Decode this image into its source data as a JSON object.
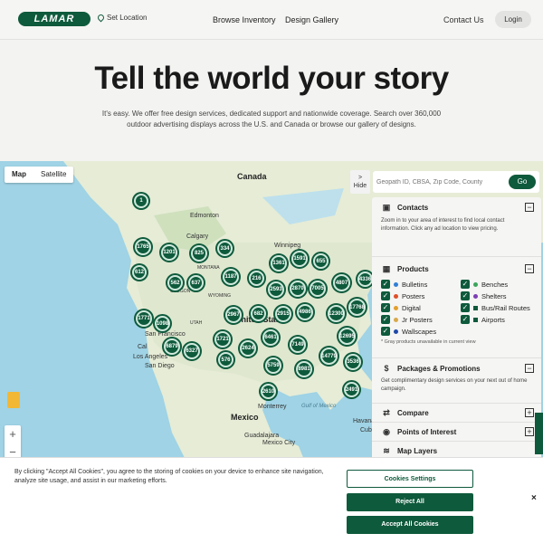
{
  "header": {
    "logo_text": "LAMAR",
    "set_location": "Set Location",
    "nav": [
      "Browse Inventory",
      "Design Gallery"
    ],
    "contact": "Contact Us",
    "login": "Login"
  },
  "hero": {
    "title": "Tell the world your story",
    "subtitle": "It's easy. We offer free design services, dedicated support and nationwide coverage. Search over 360,000 outdoor advertising displays across the U.S. and Canada or browse our gallery of designs."
  },
  "map": {
    "tabs": [
      "Map",
      "Satellite"
    ],
    "labels": {
      "canada": "Canada",
      "edmonton": "Edmonton",
      "calgary": "Calgary",
      "winnipeg": "Winnipeg",
      "montana": "MONTANA",
      "oregon": "OREGON",
      "wyoming": "WYOMING",
      "united_states": "United States",
      "utah": "UTAH",
      "san_francisco": "San Francisco",
      "los_angeles": "Los Angeles",
      "san_diego": "San Diego",
      "monterrey": "Monterrey",
      "mexico": "Mexico",
      "guadalajara": "Guadalajara",
      "mexico_city": "Mexico City",
      "gulf": "Gulf of Mexico",
      "havana": "Havana",
      "cuba": "Cuba",
      "cal": "Cal"
    },
    "clusters": [
      "1",
      "1765",
      "1201",
      "825",
      "334",
      "1361",
      "1591",
      "655",
      "612",
      "562",
      "637",
      "1187",
      "216",
      "2593",
      "2870",
      "7005",
      "4807",
      "4336",
      "2967",
      "682",
      "2915",
      "4986",
      "12300",
      "17768",
      "1771",
      "1098",
      "1721",
      "6461",
      "7149",
      "12695",
      "6879",
      "6327",
      "2624",
      "14779",
      "576",
      "5759",
      "8981",
      "3536",
      "2610",
      "2491"
    ],
    "hide": "Hide",
    "search": {
      "placeholder": "Geopath ID, CBSA, Zip Code, County",
      "go": "Go"
    },
    "zoom_in": "+",
    "zoom_out": "−"
  },
  "panel": {
    "contacts": {
      "title": "Contacts",
      "text": "Zoom in to your area of interest to find local contact information. Click any ad location to view pricing."
    },
    "products": {
      "title": "Products",
      "items": [
        {
          "label": "Bulletins",
          "color": "#2f7fd6"
        },
        {
          "label": "Benches",
          "color": "#3aa55c"
        },
        {
          "label": "Posters",
          "color": "#e0502a"
        },
        {
          "label": "Shelters",
          "color": "#7b3fb5"
        },
        {
          "label": "Digital",
          "color": "#e3a02b"
        },
        {
          "label": "Bus/Rail Routes",
          "color": "#0e5a3c"
        },
        {
          "label": "Jr Posters",
          "color": "#d8a94a"
        },
        {
          "label": "Airports",
          "color": "#0e5a3c"
        },
        {
          "label": "Wallscapes",
          "color": "#1f4aa8"
        }
      ],
      "note": "* Gray products unavailable in current view"
    },
    "packages": {
      "title": "Packages & Promotions",
      "text": "Get complimentary design services on your next out of home campaign."
    },
    "compare": "Compare",
    "poi": "Points of Interest",
    "map_layers": "Map Layers"
  },
  "cookie": {
    "text": "By clicking \"Accept All Cookies\", you agree to the storing of cookies on your device to enhance site navigation, analyze site usage, and assist in our marketing efforts.",
    "settings": "Cookies Settings",
    "reject": "Reject All",
    "accept": "Accept All Cookies",
    "close": "×"
  }
}
